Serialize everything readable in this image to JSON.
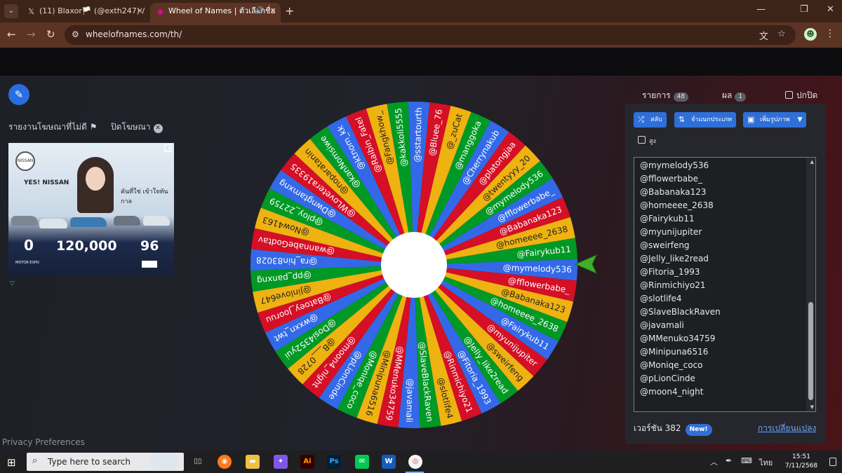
{
  "browser": {
    "tabs": [
      {
        "title": "(11) Blaxor🏳️ (@exth247) / X",
        "favicon": "x-logo-icon"
      },
      {
        "title": "Wheel of Names | ตัวเลือกชื่อ",
        "favicon": "wheel-of-names-icon"
      }
    ],
    "url": "wheelofnames.com/th/"
  },
  "sidebar_left": {
    "report_ad": "รายงานโฆษณาที่ไม่ดี",
    "close_ad": "ปิดโฆษณา",
    "ad": {
      "brand": "NISSAN",
      "tagline": "YES! NISSAN",
      "headline": "คันที่ใช่ เข้าใจทันกาล",
      "price": "120,000",
      "rate": "0",
      "months": "96",
      "event": "MOTOR EXPO"
    },
    "privacy": "Privacy Preferences"
  },
  "wheel": {
    "colors": [
      "#3369e8",
      "#d50f25",
      "#eeb211",
      "#009925"
    ],
    "entries": [
      "@mymelody536",
      "@fflowerbabe_",
      "@Babanaka123",
      "@homeeee_2638",
      "@Fairykub11",
      "@myunijupiter",
      "@sweirfeng",
      "@Jelly_like2read",
      "@Fitoria_1993",
      "@Rinmichiyo21",
      "@slotlife4",
      "@SlaveBlackRaven",
      "@javamali",
      "@MMenuko34759",
      "@Minipuna6516",
      "@Moniqe_coco",
      "@pLionCinde",
      "@moon4_night",
      "@B___0728",
      "@Dosi4352yui",
      "@wxxn_twt",
      "@Batoey_Jooruu",
      "@Jinlove647",
      "@pp_panxng",
      "@ra_hin83028",
      "@wannabeGodtav",
      "@Now4163",
      "@ploy_22759",
      "@Dwngtamxng",
      "@WLovetera19335",
      "@noparatanin",
      "@kanNomsiwe",
      "@ktnom_kk",
      "@Raibin_Fatel",
      "@Fangkhow_",
      "@kakkoli5555",
      "@sstartourth",
      "@Bluee_76",
      "@_zuCat",
      "@manggoka",
      "@Cherrynakub",
      "@platongjaa",
      "@twentyyy_20"
    ],
    "winner_pointer": "pointer-arrow-icon"
  },
  "panel": {
    "tabs": [
      {
        "label": "รายการ",
        "count": "48"
      },
      {
        "label": "ผล",
        "count": "1"
      }
    ],
    "hide_label": "ปกปิด",
    "buttons": {
      "shuffle": "สลับ",
      "sort": "จำแนกประเภท",
      "add_image": "เพิ่มรูปภาพ"
    },
    "advanced_label": "สูง",
    "list": [
      "@mymelody536",
      "@fflowerbabe_",
      "@Babanaka123",
      "@homeeee_2638",
      "@Fairykub11",
      "@myunijupiter",
      "@sweirfeng",
      "@Jelly_like2read",
      "@Fitoria_1993",
      "@Rinmichiyo21",
      "@slotlife4",
      "@SlaveBlackRaven",
      "@javamali",
      "@MMenuko34759",
      "@Minipuna6516",
      "@Moniqe_coco",
      "@pLionCinde",
      "@moon4_night"
    ],
    "version": "เวอร์ชัน 382",
    "new_badge": "New!",
    "changes_link": "การเปลี่ยนแปลง"
  },
  "taskbar": {
    "search_placeholder": "Type here to search",
    "language": "ไทย",
    "time": "15:51",
    "date": "7/11/2568"
  }
}
